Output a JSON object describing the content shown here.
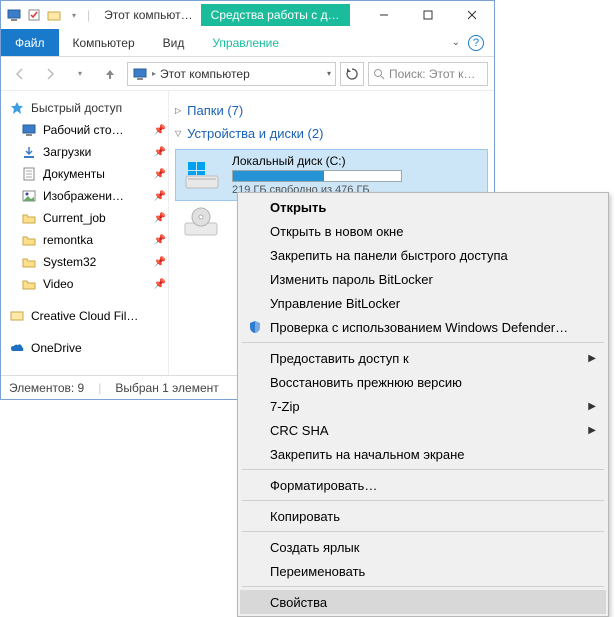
{
  "titlebar": {
    "title": "Этот компьют…",
    "contextual_tab": "Средства работы с д…"
  },
  "tabs": {
    "file": "Файл",
    "computer": "Компьютер",
    "view": "Вид",
    "management": "Управление"
  },
  "address": {
    "location": "Этот компьютер"
  },
  "search": {
    "placeholder": "Поиск: Этот к…"
  },
  "nav": {
    "quick_access": "Быстрый доступ",
    "items": [
      {
        "label": "Рабочий сто…",
        "icon": "desktop",
        "pinned": true
      },
      {
        "label": "Загрузки",
        "icon": "downloads",
        "pinned": true
      },
      {
        "label": "Документы",
        "icon": "documents",
        "pinned": true
      },
      {
        "label": "Изображени…",
        "icon": "pictures",
        "pinned": true
      },
      {
        "label": "Current_job",
        "icon": "folder",
        "pinned": true
      },
      {
        "label": "remontka",
        "icon": "folder",
        "pinned": true
      },
      {
        "label": "System32",
        "icon": "folder",
        "pinned": true
      },
      {
        "label": "Video",
        "icon": "folder",
        "pinned": true
      }
    ],
    "creative_cloud": "Creative Cloud Fil…",
    "onedrive": "OneDrive"
  },
  "content": {
    "folders_header": "Папки (7)",
    "devices_header": "Устройства и диски (2)",
    "drive": {
      "name": "Локальный диск (C:)",
      "free_text": "219 ГБ свободно из 476 ГБ",
      "fill_percent": 54
    }
  },
  "statusbar": {
    "elements": "Элементов: 9",
    "selected": "Выбран 1 элемент"
  },
  "contextmenu": {
    "open": "Открыть",
    "open_new": "Открыть в новом окне",
    "pin_quick": "Закрепить на панели быстрого доступа",
    "change_bitlocker": "Изменить пароль BitLocker",
    "manage_bitlocker": "Управление BitLocker",
    "defender": "Проверка с использованием Windows Defender…",
    "share": "Предоставить доступ к",
    "restore": "Восстановить прежнюю версию",
    "sevenzip": "7-Zip",
    "crcsha": "CRC SHA",
    "pin_start": "Закрепить на начальном экране",
    "format": "Форматировать…",
    "copy": "Копировать",
    "shortcut": "Создать ярлык",
    "rename": "Переименовать",
    "properties": "Свойства"
  }
}
